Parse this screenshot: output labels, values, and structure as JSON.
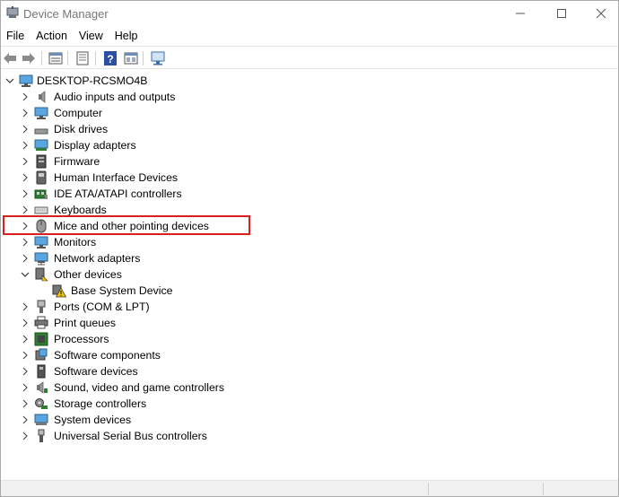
{
  "window": {
    "title": "Device Manager"
  },
  "menu": [
    "File",
    "Action",
    "View",
    "Help"
  ],
  "toolbar": {
    "buttons": [
      "back-icon",
      "forward-icon",
      "properties-icon",
      "update-driver-icon",
      "help-icon",
      "show-hidden-icon",
      "scan-hardware-icon"
    ]
  },
  "tree": {
    "root": "DESKTOP-RCSMO4B",
    "categories": [
      {
        "label": "Audio inputs and outputs",
        "icon": "speaker-icon",
        "expanded": false
      },
      {
        "label": "Computer",
        "icon": "monitor-icon",
        "expanded": false
      },
      {
        "label": "Disk drives",
        "icon": "disk-drive-icon",
        "expanded": false
      },
      {
        "label": "Display adapters",
        "icon": "display-adapter-icon",
        "expanded": false
      },
      {
        "label": "Firmware",
        "icon": "firmware-icon",
        "expanded": false
      },
      {
        "label": "Human Interface Devices",
        "icon": "hid-icon",
        "expanded": false
      },
      {
        "label": "IDE ATA/ATAPI controllers",
        "icon": "ide-controller-icon",
        "expanded": false
      },
      {
        "label": "Keyboards",
        "icon": "keyboard-icon",
        "expanded": false
      },
      {
        "label": "Mice and other pointing devices",
        "icon": "mouse-icon",
        "expanded": false,
        "highlighted": true
      },
      {
        "label": "Monitors",
        "icon": "monitor-icon",
        "expanded": false
      },
      {
        "label": "Network adapters",
        "icon": "network-adapter-icon",
        "expanded": false
      },
      {
        "label": "Other devices",
        "icon": "other-devices-icon",
        "expanded": true,
        "children": [
          {
            "label": "Base System Device",
            "icon": "warning-device-icon"
          }
        ]
      },
      {
        "label": "Ports (COM & LPT)",
        "icon": "port-icon",
        "expanded": false
      },
      {
        "label": "Print queues",
        "icon": "printer-icon",
        "expanded": false
      },
      {
        "label": "Processors",
        "icon": "processor-icon",
        "expanded": false
      },
      {
        "label": "Software components",
        "icon": "software-component-icon",
        "expanded": false
      },
      {
        "label": "Software devices",
        "icon": "software-device-icon",
        "expanded": false
      },
      {
        "label": "Sound, video and game controllers",
        "icon": "sound-icon",
        "expanded": false
      },
      {
        "label": "Storage controllers",
        "icon": "storage-controller-icon",
        "expanded": false
      },
      {
        "label": "System devices",
        "icon": "system-devices-icon",
        "expanded": false
      },
      {
        "label": "Universal Serial Bus controllers",
        "icon": "usb-icon",
        "expanded": false
      }
    ]
  },
  "colors": {
    "highlight_border": "#d9201f"
  }
}
